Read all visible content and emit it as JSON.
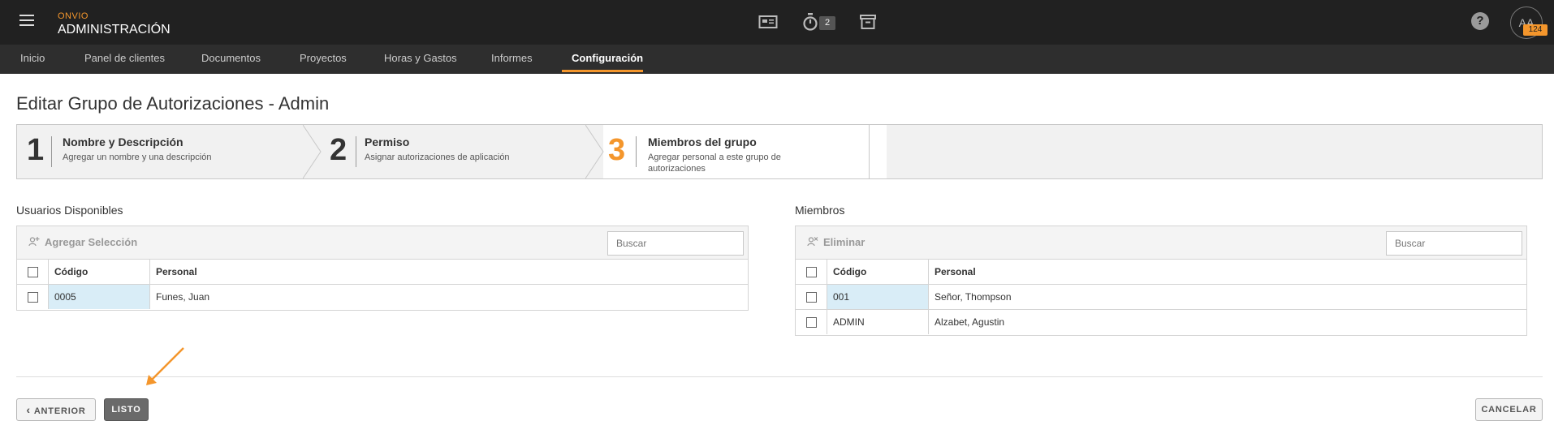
{
  "header": {
    "brand_small": "ONVIO",
    "brand_title": "ADMINISTRACIÓN",
    "timer_count": "2",
    "avatar_initials": "AA",
    "avatar_badge": "124",
    "help_glyph": "?"
  },
  "nav": {
    "items": [
      "Inicio",
      "Panel de clientes",
      "Documentos",
      "Proyectos",
      "Horas y Gastos",
      "Informes",
      "Configuración"
    ],
    "active": "Configuración"
  },
  "page": {
    "title": "Editar Grupo de Autorizaciones - Admin"
  },
  "stepper": {
    "steps": [
      {
        "number": "1",
        "title": "Nombre y Descripción",
        "desc": "Agregar un nombre y una descripción"
      },
      {
        "number": "2",
        "title": "Permiso",
        "desc": "Asignar autorizaciones de aplicación"
      },
      {
        "number": "3",
        "title": "Miembros del grupo",
        "desc_line1": "Agregar personal a este grupo de",
        "desc_line2": "autorizaciones"
      }
    ]
  },
  "available": {
    "label": "Usuarios Disponibles",
    "action": "Agregar Selección",
    "search_placeholder": "Buscar",
    "columns": [
      "Código",
      "Personal"
    ],
    "rows": [
      {
        "code": "0005",
        "name": "Funes, Juan"
      }
    ]
  },
  "members": {
    "label": "Miembros",
    "action": "Eliminar",
    "search_placeholder": "Buscar",
    "columns": [
      "Código",
      "Personal"
    ],
    "rows": [
      {
        "code": "001",
        "name": "Señor, Thompson"
      },
      {
        "code": "ADMIN",
        "name": "Alzabet, Agustin"
      }
    ]
  },
  "footer": {
    "back_label": "ANTERIOR",
    "back_glyph": "‹",
    "done_label": "LISTO",
    "cancel_label": "CANCELAR"
  },
  "colors": {
    "accent": "#f4962c",
    "topbar": "#212121",
    "nav": "#2e2e2e",
    "selected_cell": "#d9edf7"
  },
  "icons": [
    "menu-icon",
    "contact-card-icon",
    "timer-icon",
    "archive-box-icon",
    "help-icon",
    "add-user-icon",
    "remove-user-icon",
    "chevron-left-icon",
    "annotation-arrow"
  ]
}
